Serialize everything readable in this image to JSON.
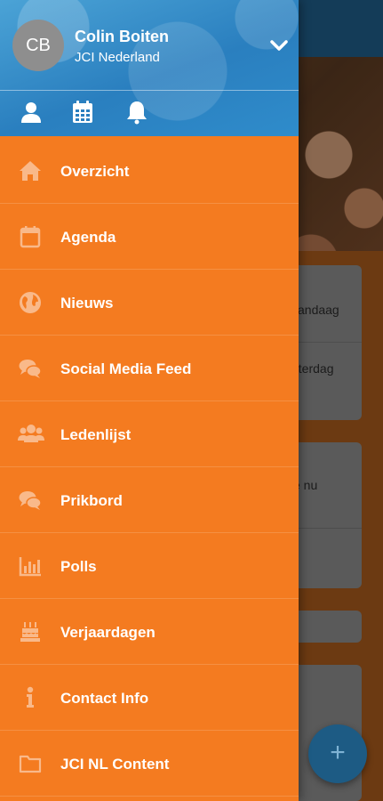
{
  "user": {
    "initials": "CB",
    "name": "Colin Boiten",
    "organization": "JCI Nederland"
  },
  "header_icons": [
    "profile-icon",
    "calendar-icon",
    "bell-icon"
  ],
  "menu": {
    "items": [
      {
        "label": "Overzicht",
        "icon": "home-icon"
      },
      {
        "label": "Agenda",
        "icon": "calendar-icon"
      },
      {
        "label": "Nieuws",
        "icon": "globe-icon"
      },
      {
        "label": "Social Media Feed",
        "icon": "chat-bubbles-icon"
      },
      {
        "label": "Ledenlijst",
        "icon": "users-icon"
      },
      {
        "label": "Prikbord",
        "icon": "chat-bubbles-icon"
      },
      {
        "label": "Polls",
        "icon": "bar-chart-icon"
      },
      {
        "label": "Verjaardagen",
        "icon": "birthday-cake-icon"
      },
      {
        "label": "Contact Info",
        "icon": "info-icon"
      },
      {
        "label": "JCI NL Content",
        "icon": "folder-icon"
      }
    ]
  },
  "background": {
    "card1_line1": "vandaag",
    "card1_line2": "aterdag",
    "card2_line1": "e nu",
    "fab_label": "+"
  },
  "colors": {
    "drawer": "#f47b20",
    "header": "#2a7fbf",
    "topbar": "#1f5d87"
  }
}
